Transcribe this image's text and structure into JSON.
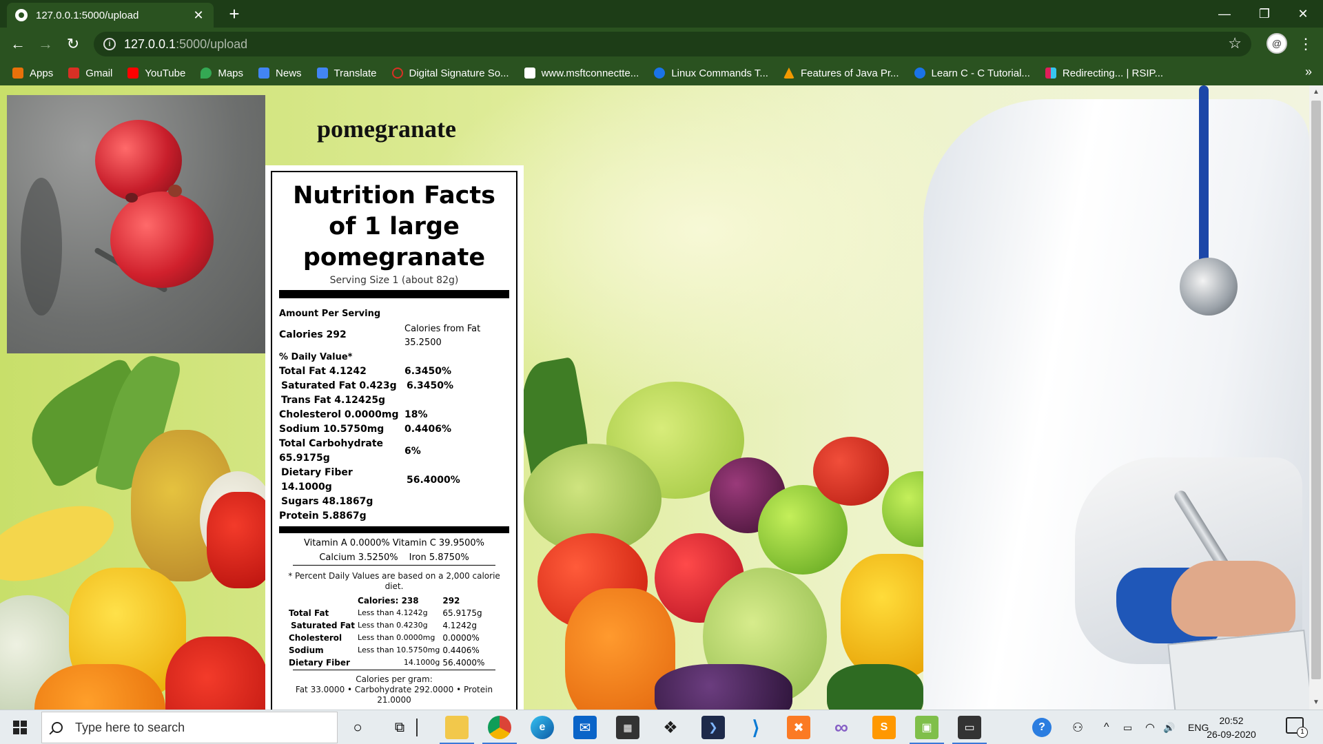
{
  "browser": {
    "tab_title": "127.0.0.1:5000/upload",
    "tab_close": "✕",
    "new_tab": "+",
    "window_controls": {
      "minimize": "—",
      "restore": "❐",
      "close": "✕"
    },
    "nav": {
      "back": "←",
      "forward": "→",
      "reload": "↻"
    },
    "url_host": "127.0.0.1",
    "url_path": ":5000/upload",
    "bookmark_star": "☆",
    "menu": "⋮",
    "bookmarks": [
      {
        "label": "Apps",
        "icon": "apps-grid-icon",
        "color": "#e8710a"
      },
      {
        "label": "Gmail",
        "icon": "gmail-icon",
        "color": "#d93025"
      },
      {
        "label": "YouTube",
        "icon": "youtube-icon",
        "color": "#ff0000"
      },
      {
        "label": "Maps",
        "icon": "maps-icon",
        "color": "#34a853"
      },
      {
        "label": "News",
        "icon": "news-icon",
        "color": "#4285f4"
      },
      {
        "label": "Translate",
        "icon": "translate-icon",
        "color": "#4285f4"
      },
      {
        "label": "Digital Signature So...",
        "icon": "digital-signature-icon",
        "color": "#d93025"
      },
      {
        "label": "www.msftconnectte...",
        "icon": "yahoo-icon",
        "color": "#ffffff"
      },
      {
        "label": "Linux Commands T...",
        "icon": "linux-icon",
        "color": "#1a73e8"
      },
      {
        "label": "Features of Java Pr...",
        "icon": "java-icon",
        "color": "#f29900"
      },
      {
        "label": "Learn C - C Tutorial...",
        "icon": "learn-c-icon",
        "color": "#1a73e8"
      },
      {
        "label": "Redirecting... | RSIP...",
        "icon": "slack-icon",
        "color": "#e01e5a"
      }
    ],
    "bookmarks_more": "»"
  },
  "page": {
    "fruit_name": "pomegranate",
    "nutrition": {
      "title": "Nutrition Facts of 1 large pomegranate",
      "serving_size": "Serving Size 1 (about 82g)",
      "amount_per_serving": "Amount Per Serving",
      "calories": "Calories 292",
      "calories_from_fat": "Calories from Fat 35.2500",
      "daily_value_header": "% Daily Value*",
      "rows": [
        {
          "label": "Total Fat 4.1242",
          "value": "6.3450%",
          "bold": true,
          "indent": false
        },
        {
          "label": "Saturated Fat 0.423g",
          "value": "6.3450%",
          "bold": true,
          "indent": true
        },
        {
          "label": "Trans Fat 4.12425g",
          "value": "",
          "bold": true,
          "indent": true
        },
        {
          "label": "Cholesterol 0.0000mg",
          "value": "18%",
          "bold": true,
          "indent": false
        },
        {
          "label": "Sodium 10.5750mg",
          "value": "0.4406%",
          "bold": true,
          "indent": false
        },
        {
          "label": "Total Carbohydrate 65.9175g",
          "value": "6%",
          "bold": true,
          "indent": false
        },
        {
          "label": "Dietary Fiber 14.1000g",
          "value": "56.4000%",
          "bold": true,
          "indent": true
        },
        {
          "label": "Sugars 48.1867g",
          "value": "",
          "bold": true,
          "indent": true
        },
        {
          "label": "Protein 5.8867g",
          "value": "",
          "bold": true,
          "indent": false
        }
      ],
      "vitamins": {
        "vitamin_a": "Vitamin A 0.0000%",
        "vitamin_c": "Vitamin C 39.9500%",
        "calcium": "Calcium 3.5250%",
        "iron": "Iron 5.8750%"
      },
      "footnote": "* Percent Daily Values are based on a 2,000 calorie diet.",
      "dv_table": {
        "header": {
          "label": "",
          "col1": "Calories: 238",
          "col2": "292"
        },
        "rows": [
          {
            "label": "Total Fat",
            "lt": "Less than 4.1242g",
            "v": "65.9175g"
          },
          {
            "label": "Saturated Fat",
            "lt": "Less than 0.4230g",
            "v": "4.1242g"
          },
          {
            "label": "Cholesterol",
            "lt": "Less than 0.0000mg",
            "v": "0.0000%"
          },
          {
            "label": "Sodium",
            "lt": "Less than 10.5750mg",
            "v": "0.4406%"
          },
          {
            "label": "Dietary Fiber",
            "lt": "14.1000g",
            "v": "56.4000%"
          }
        ]
      },
      "calories_per_gram_header": "Calories per gram:",
      "calories_per_gram": "Fat 33.0000 • Carbohydrate 292.0000 • Protein 21.0000"
    }
  },
  "taskbar": {
    "search_placeholder": "Type here to search",
    "apps": [
      {
        "name": "cortana-icon",
        "glyph": "○"
      },
      {
        "name": "task-view-icon",
        "glyph": "⧉"
      },
      {
        "name": "file-explorer-icon",
        "glyph": "📁"
      },
      {
        "name": "chrome-icon",
        "glyph": "◉"
      },
      {
        "name": "edge-icon",
        "glyph": "e"
      },
      {
        "name": "mail-icon",
        "glyph": "✉"
      },
      {
        "name": "store-icon",
        "glyph": "🛍"
      },
      {
        "name": "dropbox-icon",
        "glyph": "❖"
      },
      {
        "name": "powershell-icon",
        "glyph": "❯"
      },
      {
        "name": "vscode-icon",
        "glyph": "⟩"
      },
      {
        "name": "xampp-icon",
        "glyph": "✖"
      },
      {
        "name": "visual-studio-icon",
        "glyph": "∞"
      },
      {
        "name": "sublime-icon",
        "glyph": "S"
      },
      {
        "name": "image-viewer-icon",
        "glyph": "▣"
      },
      {
        "name": "terminal-icon",
        "glyph": "▭"
      }
    ],
    "tray": {
      "help": "?",
      "people": "⚇",
      "chevron": "^",
      "battery": "▭",
      "wifi": "◠",
      "volume": "🔊",
      "language": "ENG",
      "time": "20:52",
      "date": "26-09-2020",
      "notifications": "1"
    }
  }
}
